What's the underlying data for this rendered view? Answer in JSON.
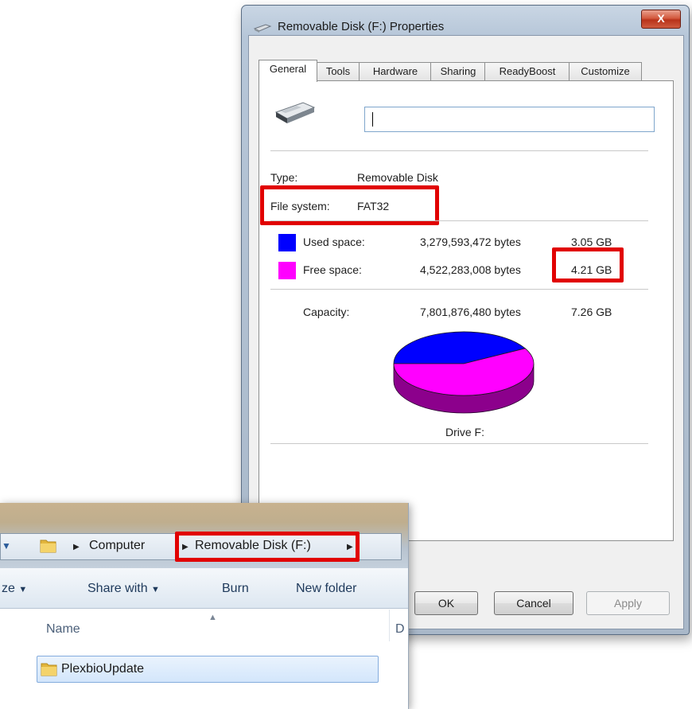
{
  "dialog": {
    "title": "Removable Disk (F:) Properties",
    "close_glyph": "X",
    "tabs": [
      "General",
      "Tools",
      "Hardware",
      "Sharing",
      "ReadyBoost",
      "Customize"
    ],
    "active_tab": "General",
    "volume_label_value": "",
    "type_label": "Type:",
    "type_value": "Removable Disk",
    "fs_label": "File system:",
    "fs_value": "FAT32",
    "used": {
      "label": "Used space:",
      "bytes": "3,279,593,472 bytes",
      "size": "3.05 GB",
      "color": "#0000ff"
    },
    "free": {
      "label": "Free space:",
      "bytes": "4,522,283,008 bytes",
      "size": "4.21 GB",
      "color": "#ff00ff"
    },
    "capacity": {
      "label": "Capacity:",
      "bytes": "7,801,876,480 bytes",
      "size": "7.26 GB"
    },
    "drive_caption": "Drive F:",
    "buttons": {
      "ok": "OK",
      "cancel": "Cancel",
      "apply": "Apply"
    }
  },
  "chart_data": {
    "type": "pie",
    "categories": [
      "Used space",
      "Free space"
    ],
    "values": [
      3279593472,
      4522283008
    ],
    "colors": [
      "#0000ff",
      "#ff00ff"
    ],
    "title": "Drive F:"
  },
  "explorer": {
    "breadcrumb": [
      "Computer",
      "Removable Disk (F:)"
    ],
    "toolbar": {
      "organize_fragment": "ze",
      "share_with": "Share with",
      "burn": "Burn",
      "new_folder": "New folder"
    },
    "columns": {
      "name": "Name",
      "date_fragment": "D"
    },
    "items": [
      {
        "name": "PlexbioUpdate"
      }
    ]
  },
  "annotations": {
    "highlight_color": "#e10000"
  },
  "icons": [
    "drive-icon",
    "close-icon",
    "folder-icon",
    "back-arrow-icon",
    "chevron-down-icon"
  ]
}
